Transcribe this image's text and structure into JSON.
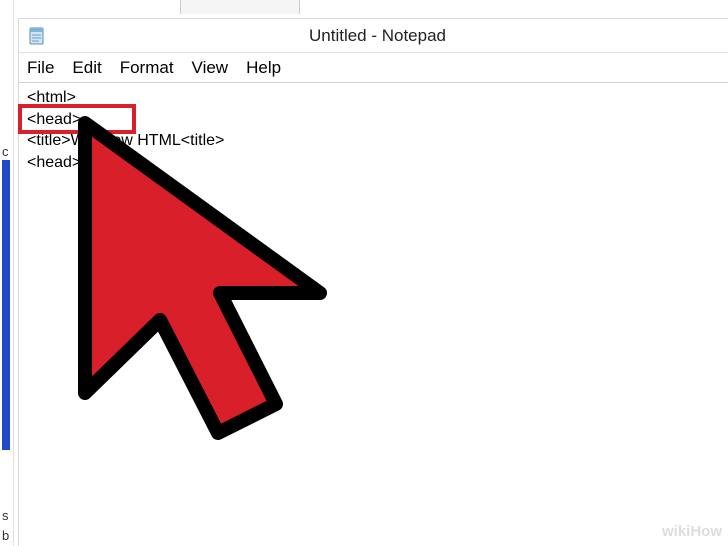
{
  "window": {
    "title": "Untitled - Notepad"
  },
  "menu": {
    "file": "File",
    "edit": "Edit",
    "format": "Format",
    "view": "View",
    "help": "Help"
  },
  "editor": {
    "lines": [
      "<html>",
      "<head>",
      "<title>WikiHow HTML<title>",
      "<head>"
    ]
  },
  "sidebar": {
    "c": "c",
    "s": "s",
    "b": "b"
  },
  "watermark": "wikiHow"
}
